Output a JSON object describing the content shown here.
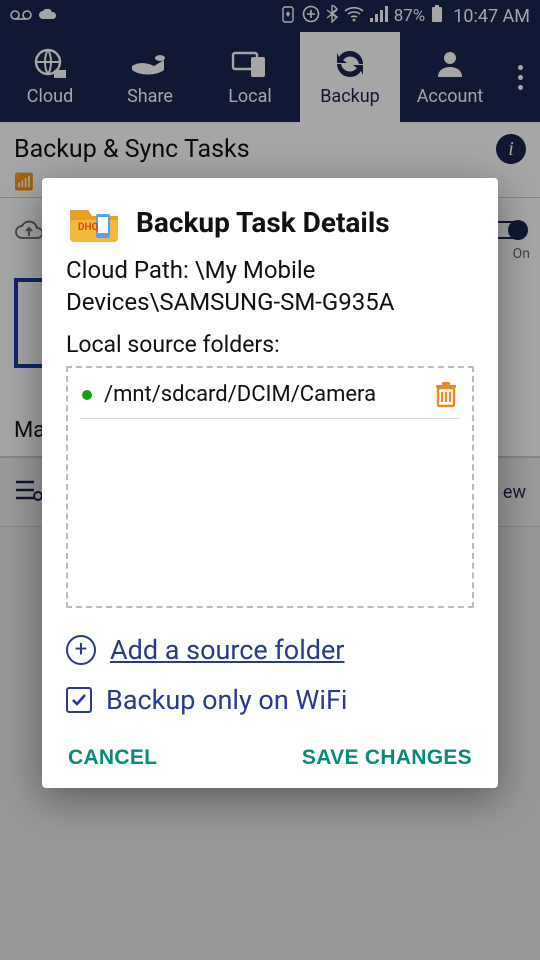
{
  "status": {
    "battery_pct": "87%",
    "time": "10:47 AM"
  },
  "tabs": {
    "cloud": "Cloud",
    "share": "Share",
    "local": "Local",
    "backup": "Backup",
    "account": "Account"
  },
  "page": {
    "title": "Backup & Sync Tasks",
    "wifi_status_prefix": "📶 ",
    "bg_switch_label": "On",
    "bg_mask_text": "Ma",
    "bg_right_text": "ew"
  },
  "dialog": {
    "title": "Backup Task Details",
    "cloud_path_label": "Cloud Path:",
    "cloud_path_value": "\\My Mobile Devices\\SAMSUNG-SM-G935A",
    "local_label": "Local source folders:",
    "folders": [
      {
        "path": "/mnt/sdcard/DCIM/Camera"
      }
    ],
    "add_source": "Add a source folder",
    "wifi_only": "Backup only on WiFi",
    "wifi_only_checked": true,
    "cancel": "CANCEL",
    "save": "SAVE CHANGES"
  }
}
